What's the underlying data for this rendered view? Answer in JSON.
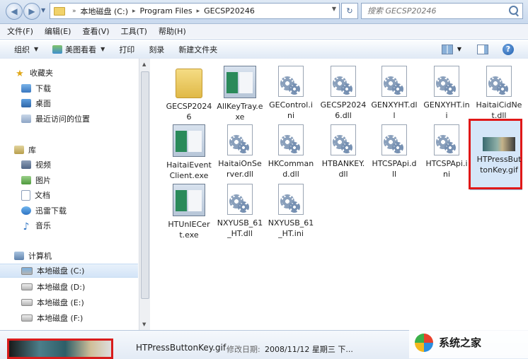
{
  "address": {
    "crumbs": [
      "本地磁盘 (C:)",
      "Program Files",
      "GECSP20246"
    ],
    "search_placeholder": "搜索 GECSP20246"
  },
  "menu": [
    "文件(F)",
    "编辑(E)",
    "查看(V)",
    "工具(T)",
    "帮助(H)"
  ],
  "toolbar": {
    "organize": "组织",
    "view_picture": "美图看看",
    "print": "打印",
    "burn": "刻录",
    "new_folder": "新建文件夹"
  },
  "nav": {
    "favorites": "收藏夹",
    "downloads": "下载",
    "desktop": "桌面",
    "recent": "最近访问的位置",
    "libraries": "库",
    "videos": "视频",
    "pictures": "图片",
    "documents": "文档",
    "xunlei": "迅雷下载",
    "music": "音乐",
    "computer": "计算机",
    "drive_c": "本地磁盘 (C:)",
    "drive_d": "本地磁盘 (D:)",
    "drive_e": "本地磁盘 (E:)",
    "drive_f": "本地磁盘 (F:)"
  },
  "files": [
    {
      "name": "GECSP20246",
      "type": "folder"
    },
    {
      "name": "AllKeyTray.exe",
      "type": "exe"
    },
    {
      "name": "GEControl.ini",
      "type": "ini"
    },
    {
      "name": "GECSP20246.dll",
      "type": "dll"
    },
    {
      "name": "GENXYHT.dll",
      "type": "dll"
    },
    {
      "name": "GENXYHT.ini",
      "type": "ini"
    },
    {
      "name": "HaitaiCidNet.dll",
      "type": "dll"
    },
    {
      "name": "HaitaiEventClient.exe",
      "type": "exe"
    },
    {
      "name": "HaitaiOnServer.dll",
      "type": "dll"
    },
    {
      "name": "HKCommand.dll",
      "type": "dll"
    },
    {
      "name": "HTBANKEY.dll",
      "type": "dll"
    },
    {
      "name": "HTCSPApi.dll",
      "type": "dll"
    },
    {
      "name": "HTCSPApi.ini",
      "type": "ini"
    },
    {
      "name": "HTPressButtonKey.gif",
      "type": "gif"
    },
    {
      "name": "HTUnIECert.exe",
      "type": "exe"
    },
    {
      "name": "NXYUSB_61_HT.dll",
      "type": "dll"
    },
    {
      "name": "NXYUSB_61_HT.ini",
      "type": "ini"
    }
  ],
  "details": {
    "name": "HTPressButtonKey.gif",
    "modified_label": "修改日期:",
    "modified_value": "2008/11/12 星期三 下..."
  },
  "watermark": {
    "text": "系统之家"
  }
}
